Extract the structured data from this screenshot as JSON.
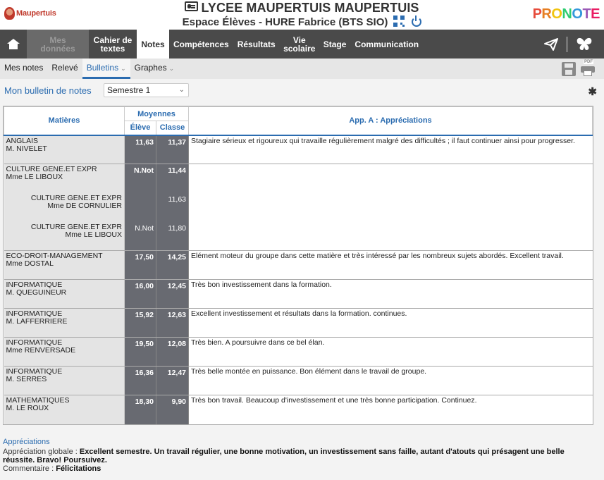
{
  "header": {
    "logo_text": "Maupertuis",
    "school_name": "LYCEE MAUPERTUIS MAUPERTUIS",
    "espace": "Espace Élèves - HURE Fabrice (BTS SIO)",
    "brand": [
      "P",
      "R",
      "O",
      "N",
      "O",
      "T",
      "E"
    ]
  },
  "nav": {
    "items": [
      "Mes données",
      "Cahier de textes",
      "Notes",
      "Compétences",
      "Résultats",
      "Vie scolaire",
      "Stage",
      "Communication"
    ]
  },
  "subnav": {
    "items": [
      "Mes notes",
      "Relevé",
      "Bulletins",
      "Graphes"
    ]
  },
  "toolbar": {
    "title": "Mon bulletin de notes",
    "period": "Semestre 1"
  },
  "table": {
    "headers": {
      "matieres": "Matières",
      "moyennes": "Moyennes",
      "eleve": "Élève",
      "classe": "Classe",
      "appreciations": "App. A : Appréciations"
    },
    "rows": [
      {
        "subject": "ANGLAIS",
        "teacher": "M. NIVELET",
        "eleve": "11,63",
        "classe": "11,37",
        "app": "Stagiaire sérieux et rigoureux qui travaille régulièrement malgré des difficultés ; il faut continuer ainsi pour progresser."
      },
      {
        "subject": "CULTURE GENE.ET EXPR",
        "teacher": "Mme LE LIBOUX",
        "eleve": "N.Not",
        "classe": "11,44",
        "app": ""
      },
      {
        "subject": "CULTURE GENE.ET EXPR",
        "teacher": "Mme DE CORNULIER",
        "eleve": "",
        "classe": "11,63",
        "app": ""
      },
      {
        "subject": "CULTURE GENE.ET EXPR",
        "teacher": "Mme LE LIBOUX",
        "eleve": "N.Not",
        "classe": "11,80",
        "app": ""
      },
      {
        "subject": "ECO-DROIT-MANAGEMENT",
        "teacher": "Mme DOSTAL",
        "eleve": "17,50",
        "classe": "14,25",
        "app": "Elément moteur du groupe dans cette matière et très intéressé par les nombreux sujets abordés. Excellent travail."
      },
      {
        "subject": "INFORMATIQUE",
        "teacher": "M. QUEGUINEUR",
        "eleve": "16,00",
        "classe": "12,45",
        "app": "Très bon investissement dans la formation."
      },
      {
        "subject": "INFORMATIQUE",
        "teacher": "M. LAFFERRIERE",
        "eleve": "15,92",
        "classe": "12,63",
        "app": "Excellent investissement et résultats dans la formation. continues."
      },
      {
        "subject": "INFORMATIQUE",
        "teacher": "Mme RENVERSADE",
        "eleve": "19,50",
        "classe": "12,08",
        "app": "Très bien. A poursuivre dans ce bel élan."
      },
      {
        "subject": "INFORMATIQUE",
        "teacher": "M. SERRES",
        "eleve": "16,36",
        "classe": "12,47",
        "app": "Très belle montée en puissance. Bon élément dans le travail de groupe."
      },
      {
        "subject": "MATHEMATIQUES",
        "teacher": "M. LE ROUX",
        "eleve": "18,30",
        "classe": "9,90",
        "app": "Très bon travail. Beaucoup d'investissement et une très bonne participation. Continuez."
      }
    ]
  },
  "footer": {
    "title": "Appréciations",
    "global_label": "Appréciation globale : ",
    "global_text": "Excellent semestre. Un travail régulier, une bonne motivation, un investissement sans faille, autant d'atouts qui présagent une belle réussite. Bravo! Poursuivez.",
    "comment_label": "Commentaire : ",
    "comment_text": "Félicitations"
  }
}
